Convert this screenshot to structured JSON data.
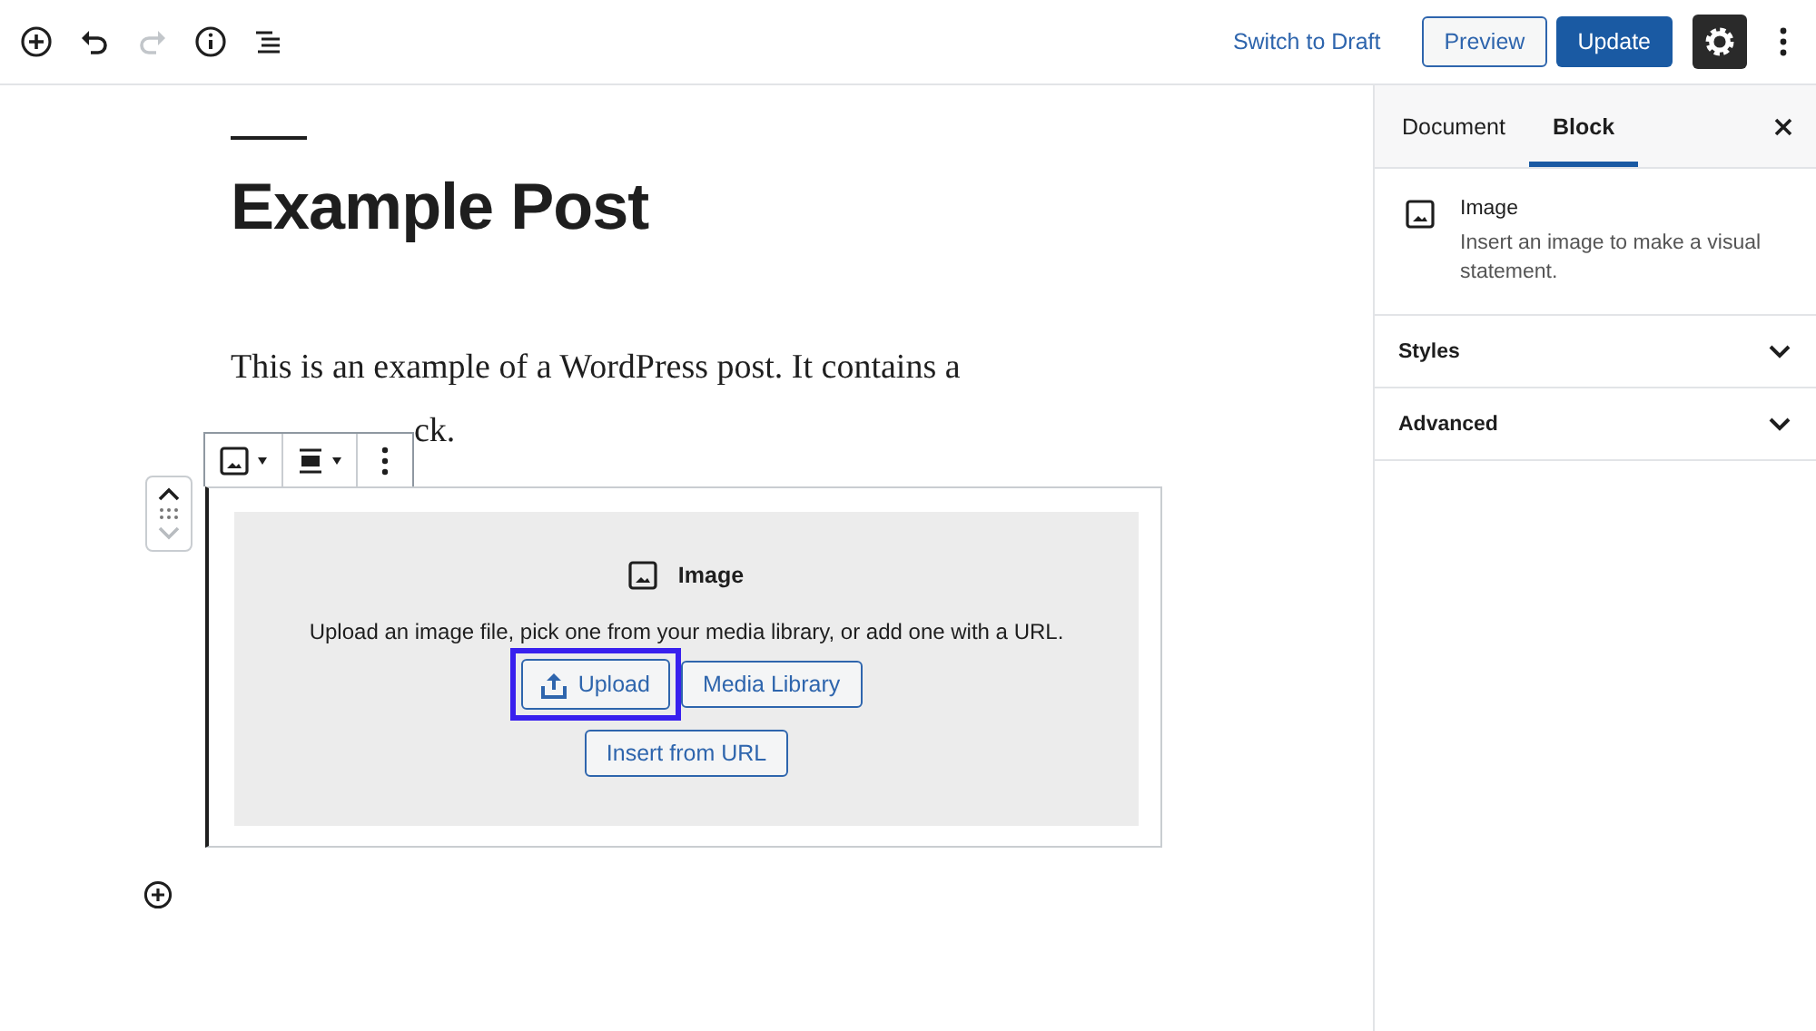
{
  "toolbar": {
    "tools": [
      {
        "kind": "add",
        "disabled": false
      },
      {
        "kind": "undo",
        "disabled": false
      },
      {
        "kind": "redo",
        "disabled": true
      },
      {
        "kind": "info",
        "disabled": false
      },
      {
        "kind": "outline",
        "disabled": false
      }
    ],
    "switch_link": "Switch to Draft",
    "preview": "Preview",
    "update": "Update",
    "settings_active": true
  },
  "editor": {
    "title": "Example Post",
    "paragraph_lines": [
      "This is an example of a WordPress post. It contains a",
      "ck."
    ],
    "mover": {
      "up_disabled": false,
      "down_disabled": true
    },
    "image_block": {
      "label": "Image",
      "instructions": "Upload an image file, pick one from your media library, or add one with a URL.",
      "buttons": [
        {
          "kind": "upload",
          "label": "Upload",
          "focused": true
        },
        {
          "kind": "plain",
          "label": "Media Library",
          "focused": false
        },
        {
          "kind": "plain",
          "label": "Insert from URL",
          "focused": false
        }
      ]
    }
  },
  "sidebar": {
    "tabs": [
      {
        "label": "Document",
        "selected": false
      },
      {
        "label": "Block",
        "selected": true
      }
    ],
    "block_card": {
      "title": "Image",
      "description": "Insert an image to make a visual statement."
    },
    "panels": [
      {
        "label": "Styles",
        "expanded": false
      },
      {
        "label": "Advanced",
        "expanded": false
      }
    ]
  }
}
